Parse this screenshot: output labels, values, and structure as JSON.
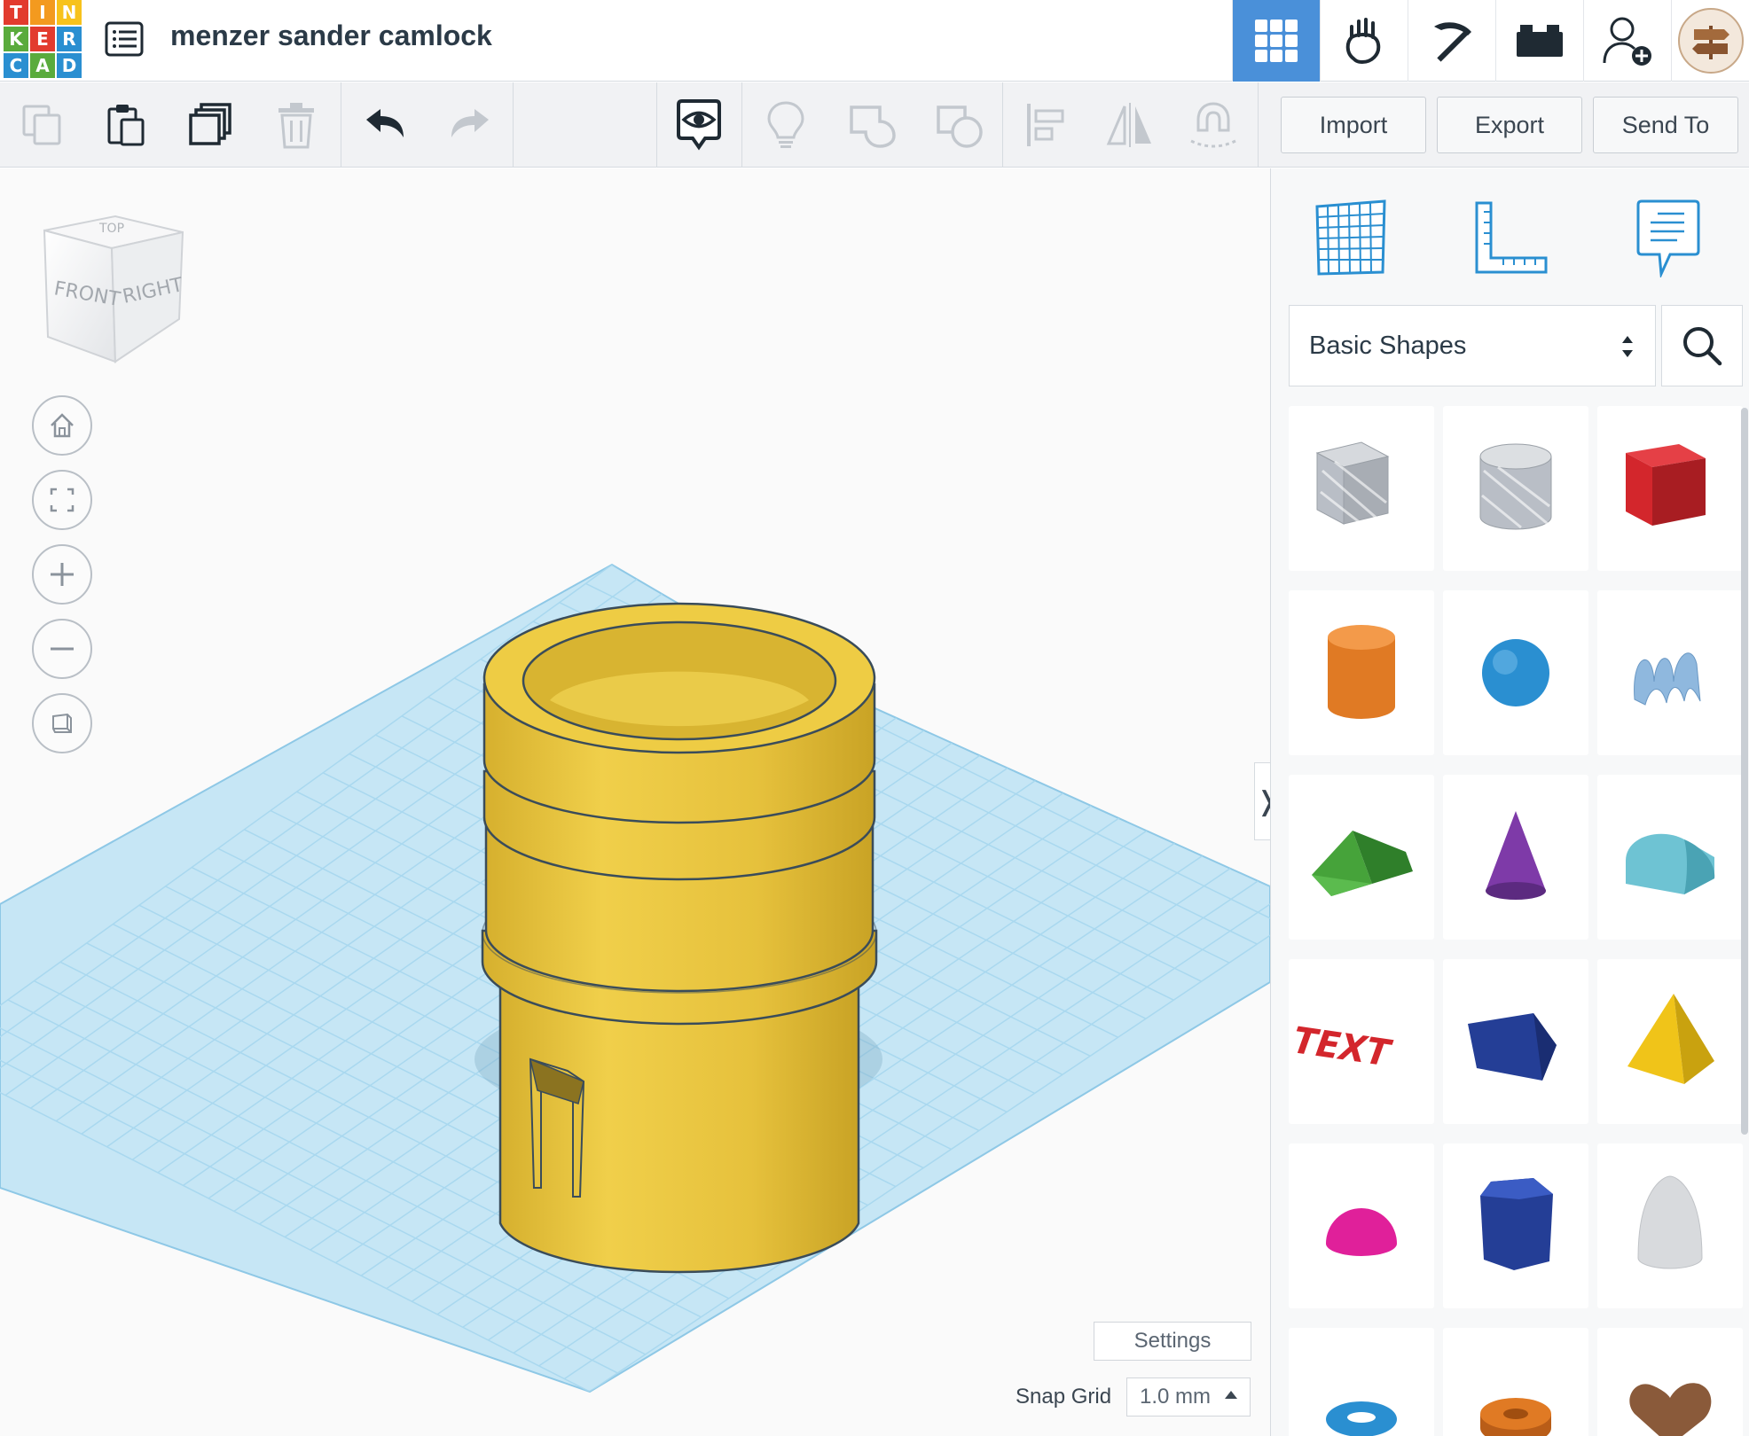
{
  "app": {
    "logo_letters": [
      "T",
      "I",
      "N",
      "K",
      "E",
      "R",
      "C",
      "A",
      "D"
    ],
    "logo_colors": [
      "#e23b2e",
      "#f39a1f",
      "#f7c21c",
      "#5aab3c",
      "#e23b2e",
      "#2a8fd1",
      "#2a8fd1",
      "#5aab3c",
      "#2a8fd1"
    ],
    "design_title": "menzer sander camlock"
  },
  "top_nav": {
    "items": [
      {
        "name": "3d-design-view",
        "icon": "grid-icon",
        "active": true
      },
      {
        "name": "circuits-view",
        "icon": "hand-icon",
        "active": false
      },
      {
        "name": "minecraft-view",
        "icon": "pickaxe-icon",
        "active": false
      },
      {
        "name": "brick-view",
        "icon": "brick-icon",
        "active": false
      },
      {
        "name": "invite-user",
        "icon": "user-add-icon",
        "active": false
      }
    ]
  },
  "toolbar": {
    "import_label": "Import",
    "export_label": "Export",
    "send_to_label": "Send To"
  },
  "viewcube": {
    "front_label": "FRONT",
    "right_label": "RIGHT"
  },
  "workplane": {
    "settings_label": "Settings",
    "snap_grid_label": "Snap Grid",
    "snap_grid_value": "1.0 mm"
  },
  "shapes_panel": {
    "category": "Basic Shapes",
    "shapes": [
      {
        "name": "box-hole",
        "color": "#b9bec6"
      },
      {
        "name": "cylinder-hole",
        "color": "#b9bec6"
      },
      {
        "name": "box",
        "color": "#d3262c"
      },
      {
        "name": "cylinder",
        "color": "#e07a24"
      },
      {
        "name": "sphere",
        "color": "#2a8fd1"
      },
      {
        "name": "scribble",
        "color": "#8fb8de"
      },
      {
        "name": "roof",
        "color": "#46a33a"
      },
      {
        "name": "cone",
        "color": "#7e3aa8"
      },
      {
        "name": "round-roof",
        "color": "#6ec3d3"
      },
      {
        "name": "text",
        "color": "#d3262c"
      },
      {
        "name": "wedge",
        "color": "#243e96"
      },
      {
        "name": "pyramid",
        "color": "#f0c419"
      },
      {
        "name": "half-sphere",
        "color": "#e0209a"
      },
      {
        "name": "polygon",
        "color": "#243e96"
      },
      {
        "name": "paraboloid",
        "color": "#d8dadd"
      },
      {
        "name": "torus",
        "color": "#2a8fd1"
      },
      {
        "name": "tube",
        "color": "#e07a24"
      },
      {
        "name": "heart",
        "color": "#8a5a3a"
      }
    ]
  },
  "colors": {
    "accent": "#4a90d9",
    "model_yellow": "#e8c43a",
    "grid_blue": "#c6e6f5"
  }
}
